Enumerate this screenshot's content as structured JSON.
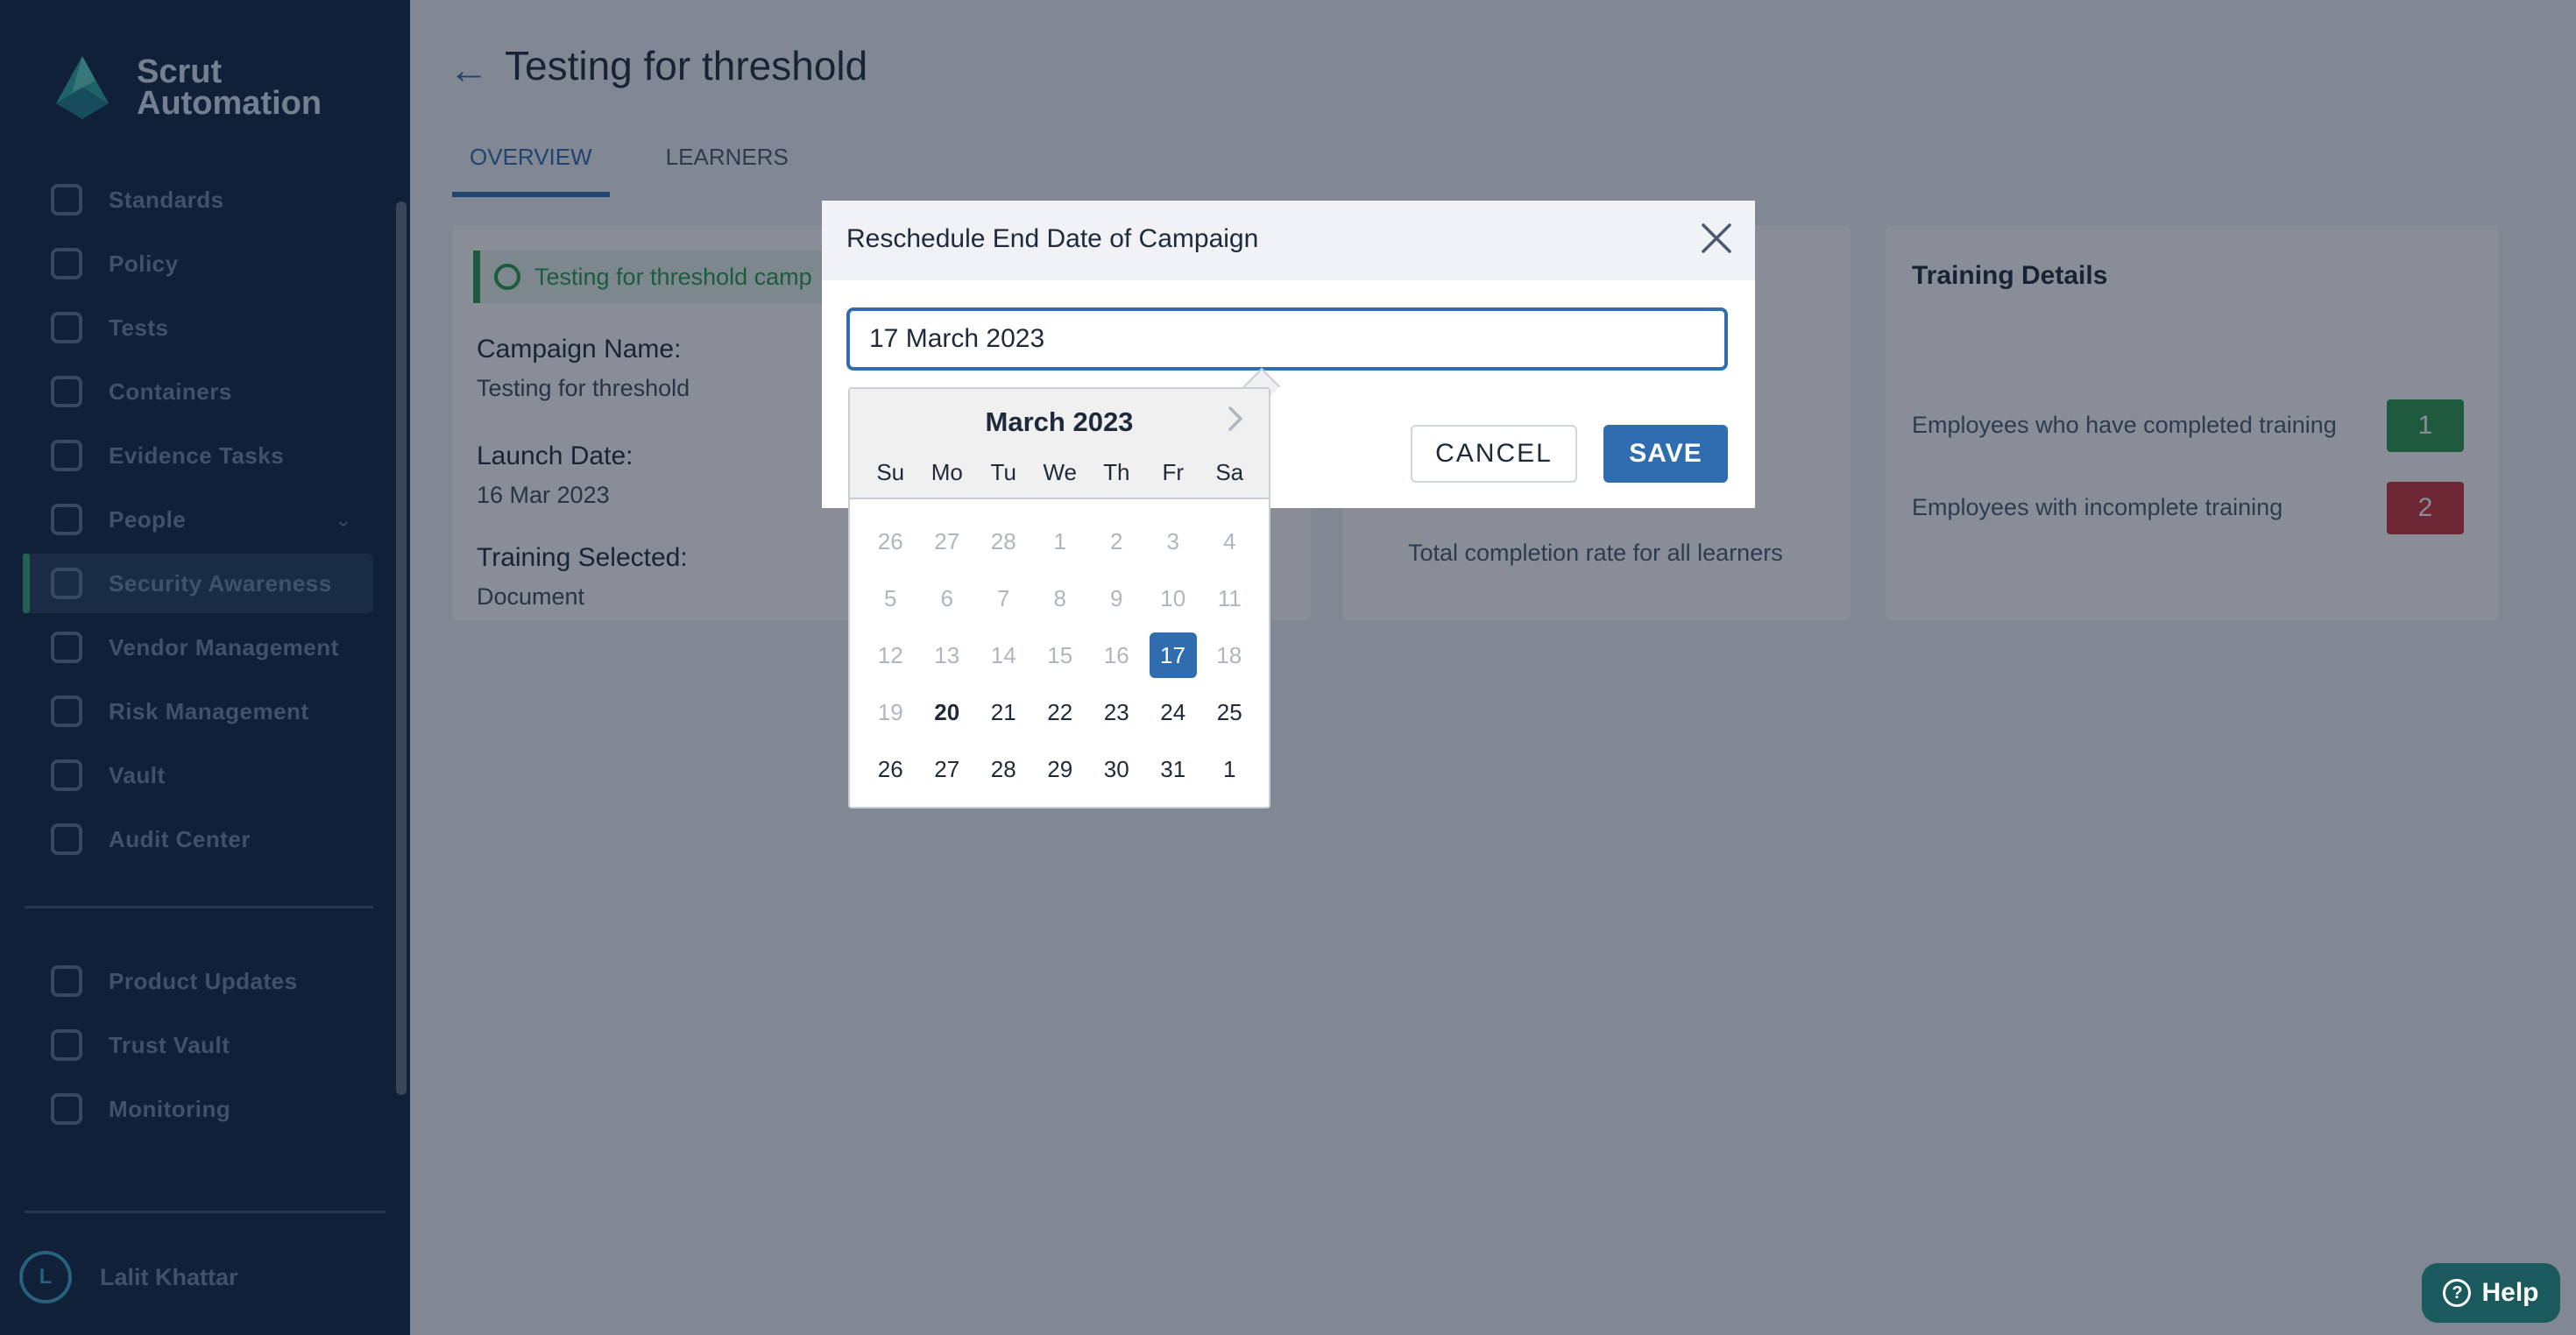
{
  "app": {
    "logo_text": "Scrut Automation",
    "logo_line1": "Scrut",
    "logo_line2": "Automation"
  },
  "sidebar": {
    "items": [
      {
        "label": "Standards",
        "icon": "standards-icon"
      },
      {
        "label": "Policy",
        "icon": "policy-icon"
      },
      {
        "label": "Tests",
        "icon": "tests-icon"
      },
      {
        "label": "Containers",
        "icon": "containers-icon"
      },
      {
        "label": "Evidence Tasks",
        "icon": "evidence-tasks-icon"
      },
      {
        "label": "People",
        "icon": "people-icon"
      },
      {
        "label": "Security Awareness",
        "icon": "security-awareness-icon"
      },
      {
        "label": "Vendor Management",
        "icon": "vendor-management-icon"
      },
      {
        "label": "Risk Management",
        "icon": "risk-management-icon"
      },
      {
        "label": "Vault",
        "icon": "vault-icon"
      },
      {
        "label": "Audit Center",
        "icon": "audit-center-icon"
      }
    ],
    "secondary_items": [
      {
        "label": "Product Updates",
        "icon": "megaphone-icon"
      },
      {
        "label": "Trust Vault",
        "icon": "flag-icon"
      },
      {
        "label": "Monitoring",
        "icon": "chart-icon"
      }
    ],
    "active_item": "Security Awareness",
    "user": {
      "initial": "L",
      "name": "Lalit Khattar"
    }
  },
  "page": {
    "title": "Testing for threshold",
    "tabs": [
      {
        "label": "OVERVIEW",
        "active": true
      },
      {
        "label": "LEARNERS",
        "active": false
      }
    ]
  },
  "overview": {
    "banner": "Testing for threshold camp",
    "fields": [
      {
        "label": "Campaign Name:",
        "value": "Testing for threshold"
      },
      {
        "label": "Launch Date:",
        "value": "16 Mar 2023"
      },
      {
        "label": "Training Selected:",
        "value": "Document"
      }
    ],
    "completion_text": "Total completion rate for all learners"
  },
  "training_details": {
    "title": "Training Details",
    "rows": [
      {
        "label": "Employees who have completed training",
        "count": "1",
        "color": "#2b9a4d"
      },
      {
        "label": "Employees with incomplete training",
        "count": "2",
        "color": "#c8333a"
      }
    ]
  },
  "modal": {
    "title": "Reschedule End Date of Campaign",
    "date_value": "17 March 2023",
    "cancel_label": "CANCEL",
    "save_label": "SAVE"
  },
  "calendar": {
    "month_label": "March 2023",
    "weekdays": [
      "Su",
      "Mo",
      "Tu",
      "We",
      "Th",
      "Fr",
      "Sa"
    ],
    "weeks": [
      [
        "26",
        "27",
        "28",
        "1",
        "2",
        "3",
        "4"
      ],
      [
        "5",
        "6",
        "7",
        "8",
        "9",
        "10",
        "11"
      ],
      [
        "12",
        "13",
        "14",
        "15",
        "16",
        "17",
        "18"
      ],
      [
        "19",
        "20",
        "21",
        "22",
        "23",
        "24",
        "25"
      ],
      [
        "26",
        "27",
        "28",
        "29",
        "30",
        "31",
        "1"
      ]
    ],
    "selected": "17",
    "today": "20"
  },
  "help": {
    "label": "Help"
  },
  "colors": {
    "primary": "#2f6db0",
    "sidebar_bg": "#0f2440",
    "success": "#2b9a4d",
    "danger": "#c8333a",
    "help_bg": "#1a5a5c"
  }
}
